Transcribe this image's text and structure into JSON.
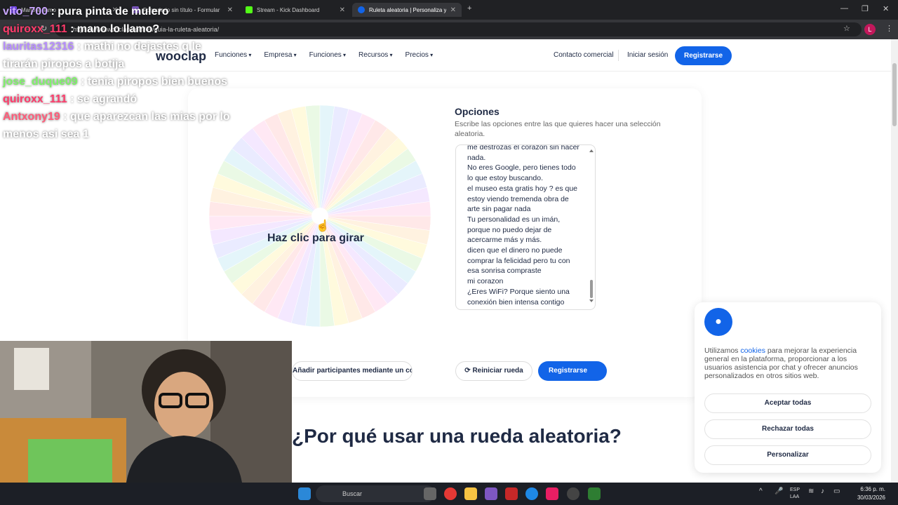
{
  "browser": {
    "tabs": [
      {
        "title": "Mano lo llamo",
        "color": "#7c4dff"
      },
      {
        "title": "Formulario sin título - Formular",
        "color": "#7e57c2"
      },
      {
        "title": "Stream - Kick Dashboard",
        "color": "#53fc18"
      },
      {
        "title": "Ruleta aleatoria | Personaliza y",
        "color": "#1264e8"
      }
    ],
    "url": "https://www.wooclap.com/es/guia-la-ruleta-aleatoria/",
    "profile_initial": "L"
  },
  "site": {
    "logo": "wooclap",
    "menu": [
      "Funciones",
      "Empresa",
      "Funciones",
      "Recursos",
      "Precios"
    ],
    "contact": "Contacto comercial",
    "login": "Iniciar sesión",
    "register": "Registrarse"
  },
  "wheel": {
    "spin_label": "Haz clic para girar",
    "segment_colors": [
      "#ffd6d6",
      "#ffe8c7",
      "#fff6c2",
      "#daf5d0",
      "#cfeef7",
      "#d9dcff",
      "#ecd6ff",
      "#ffd6ec"
    ]
  },
  "options": {
    "title": "Opciones",
    "description": "Escribe las opciones entre las que quieres hacer una selección aleatoria.",
    "lines": [
      "me destrozas el corazón sin hacer",
      "nada.",
      "No eres Google, pero tienes todo",
      "lo que estoy buscando.",
      "el museo esta gratis hoy ? es que",
      "estoy viendo tremenda obra de",
      "arte sin pagar nada",
      "Tu personalidad es un imán,",
      "porque no puedo dejar de",
      "acercarme más y más.",
      "dicen que el dinero no puede",
      "comprar la felicidad pero tu con",
      "esa sonrisa compraste",
      "mi corazon",
      "¿Eres WiFi? Porque siento una",
      "conexión bien intensa contigo"
    ]
  },
  "actions": {
    "qr": "Añadir participantes mediante un código QR",
    "reset": "Reiniciar rueda",
    "register": "Registrarse"
  },
  "section_heading": "¿Por qué usar una rueda aleatoria?",
  "cookies": {
    "text_before": "Utilizamos ",
    "link": "cookies",
    "text_after": " para mejorar la experiencia general en la plataforma, proporcionar a los usuarios asistencia por chat y ofrecer anuncios personalizados en otros sitios web.",
    "accept": "Aceptar todas",
    "reject": "Rechazar todas",
    "customize": "Personalizar"
  },
  "chat": [
    {
      "user": "vito_700",
      "text": ": pura pinta de mulero",
      "color": "#c9a6ff"
    },
    {
      "user": "quiroxx_111",
      "text": ": mano lo llamo?",
      "color": "#ff3b6b"
    },
    {
      "user": "lauritas12316",
      "text": ": mathi no dejastes q le tirarán piropos a botija",
      "color": "#b68cff"
    },
    {
      "user": "jose_duque09",
      "text": ": tenia piropos bien buenos",
      "color": "#7ff26a"
    },
    {
      "user": "quiroxx_111",
      "text": ": se agrandó",
      "color": "#ff3b6b"
    },
    {
      "user": "Antxony19",
      "text": ": que aparezcan las mias por lo menos asi sea 1",
      "color": "#ff5c7a"
    }
  ],
  "taskbar": {
    "search": "Buscar",
    "lang": "ESP",
    "region": "LAA",
    "time": "6:36 p. m.",
    "date": "30/03/2026"
  }
}
